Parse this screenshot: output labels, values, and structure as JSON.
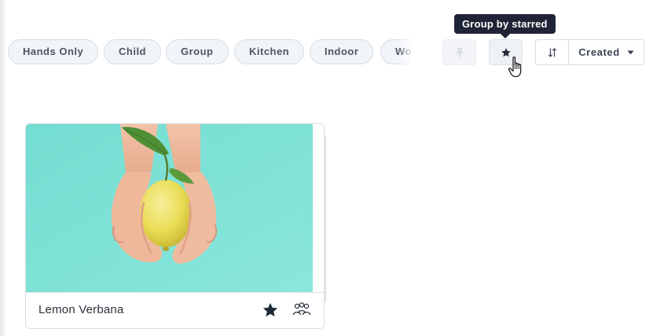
{
  "filters": {
    "chips": [
      {
        "label": "Hands Only"
      },
      {
        "label": "Child"
      },
      {
        "label": "Group"
      },
      {
        "label": "Kitchen"
      },
      {
        "label": "Indoor"
      },
      {
        "label": "Wo"
      }
    ]
  },
  "toolbar": {
    "pin_icon": "pin-icon",
    "star_icon": "star-icon",
    "sort_direction_icon": "sort-direction-icon",
    "sort_selected": "Created",
    "dropdown_icon": "caret-down-icon"
  },
  "tooltip": {
    "text": "Group by starred"
  },
  "card": {
    "title": "Lemon Verbana",
    "starred": true,
    "image": "hands-holding-lemon-on-teal",
    "icons": [
      "star-icon",
      "group-icon"
    ]
  },
  "colors": {
    "tooltip_bg": "#1f2436",
    "chip_bg": "#f1f4f8",
    "image_bg": "#7ee0d4",
    "star": "#1f2a36"
  }
}
